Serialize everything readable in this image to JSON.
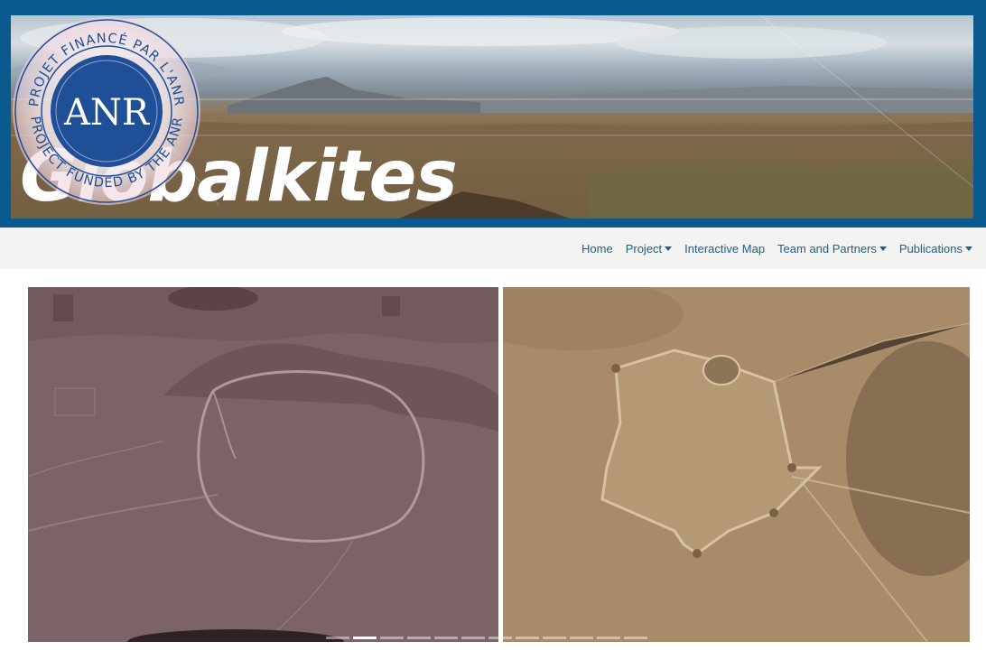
{
  "site": {
    "logo_text": "Globalkites",
    "seal": {
      "center_text": "ANR",
      "top_arc": "PROJET FINANCÉ PAR L'ANR",
      "bottom_arc": "PROJECT FUNDED BY THE ANR"
    }
  },
  "nav": {
    "items": [
      {
        "label": "Home",
        "dropdown": false
      },
      {
        "label": "Project",
        "dropdown": true
      },
      {
        "label": "Interactive Map",
        "dropdown": false
      },
      {
        "label": "Team and Partners",
        "dropdown": true
      },
      {
        "label": "Publications",
        "dropdown": true
      }
    ]
  },
  "carousel": {
    "indicator_count": 12,
    "active_index": 1
  },
  "colors": {
    "brand_blue": "#0b5a8f",
    "nav_link": "#1d5f8f",
    "navbar_bg": "#f3f4f1"
  }
}
